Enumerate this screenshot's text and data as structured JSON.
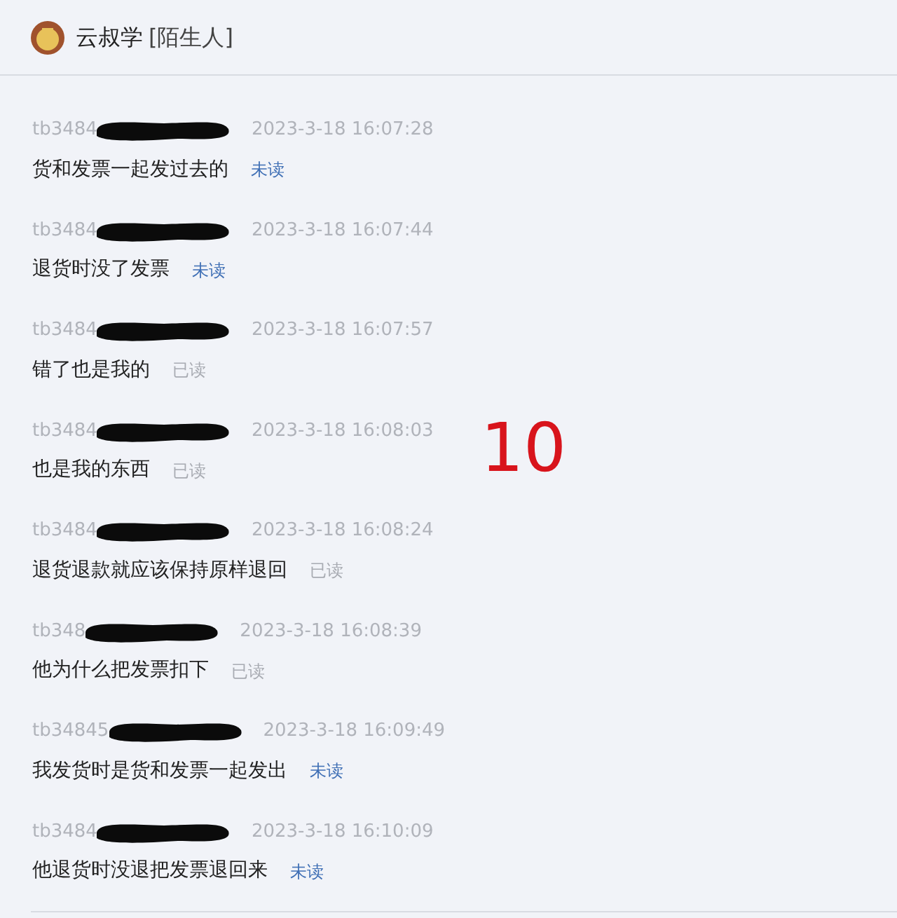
{
  "header": {
    "name": "云叔学",
    "tag": "[陌生人]"
  },
  "messages": [
    {
      "sender": "tb3484",
      "time": "2023-3-18 16:07:28",
      "text": "货和发票一起发过去的",
      "status": "未读",
      "read": false
    },
    {
      "sender": "tb3484",
      "time": "2023-3-18 16:07:44",
      "text": "退货时没了发票",
      "status": "未读",
      "read": false
    },
    {
      "sender": "tb3484",
      "time": "2023-3-18 16:07:57",
      "text": "错了也是我的",
      "status": "已读",
      "read": true
    },
    {
      "sender": "tb3484",
      "time": "2023-3-18 16:08:03",
      "text": "也是我的东西",
      "status": "已读",
      "read": true
    },
    {
      "sender": "tb3484",
      "time": "2023-3-18 16:08:24",
      "text": "退货退款就应该保持原样退回",
      "status": "已读",
      "read": true
    },
    {
      "sender": "tb348",
      "time": "2023-3-18 16:08:39",
      "text": "他为什么把发票扣下",
      "status": "已读",
      "read": true
    },
    {
      "sender": "tb34845",
      "time": "2023-3-18 16:09:49",
      "text": "我发货时是货和发票一起发出",
      "status": "未读",
      "read": false
    },
    {
      "sender": "tb3484",
      "time": "2023-3-18 16:10:09",
      "text": "他退货时没退把发票退回来",
      "status": "未读",
      "read": false
    }
  ],
  "annotation": "10"
}
